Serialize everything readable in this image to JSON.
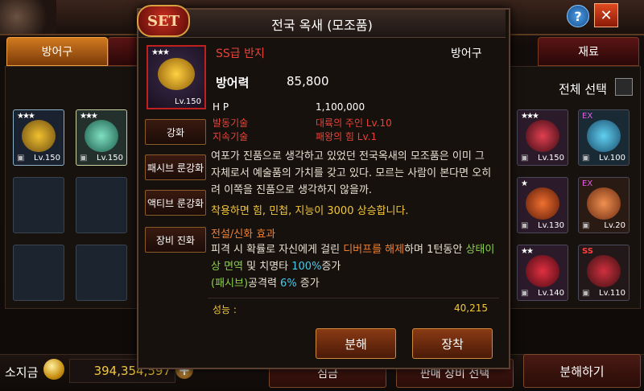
{
  "popup": {
    "badge": "SET",
    "title": "전국 옥새 (모조품)",
    "grade": "SS급 반지",
    "category": "방어구",
    "item_level": "Lv.150",
    "item_stars": "★★★",
    "main_stat_label": "방어력",
    "main_stat_value": "85,800",
    "stats": [
      {
        "label": "H P",
        "value": "1,100,000"
      },
      {
        "label": "발동기술",
        "value": "대륙의 주인 Lv.10"
      },
      {
        "label": "지속기술",
        "value": "패왕의 힘 Lv.1"
      }
    ],
    "description": [
      "여포가 진품으로 생각하고 있었던 전국옥새의 모조품은 이미 그",
      "자체로서 예술품의 가치를 갖고 있다. 모르는 사람이 본다면 오히",
      "려 이쪽을 진품으로 생각하지 않을까."
    ],
    "bonus": "착용하면 힘, 민첩, 지능이 3000 상승합니다.",
    "legend_title": "전설/신화 효과",
    "legend_line1_a": "피격 시 확률로 자신에게 걸린 ",
    "legend_line1_b": "디버프를 해제",
    "legend_line1_c": "하며 1턴동안 ",
    "legend_line1_d": "상태이",
    "legend_line2_a": "상 면역",
    "legend_line2_b": " 및 치명타 ",
    "legend_line2_c": "100%",
    "legend_line2_d": "증가",
    "legend_line3_a": "(패시브)",
    "legend_line3_b": "공격력 ",
    "legend_line3_c": "6%",
    "legend_line3_d": " 증가",
    "performance_label": "성능 :",
    "performance_value": "40,215",
    "side_buttons": [
      "강화",
      "패시브 룬강화",
      "액티브 룬강화",
      "장비 진화"
    ],
    "disassemble_label": "분해",
    "equip_label": "장착"
  },
  "tabs": {
    "armor": "방어구",
    "material": "재료"
  },
  "select_all_label": "전체 선택",
  "left_slots": [
    {
      "stars": "★★★",
      "level": "Lv.150",
      "color": "#d4a020"
    },
    {
      "stars": "★★★",
      "level": "Lv.150",
      "color": "#48b8a0"
    }
  ],
  "right_slots": [
    {
      "badge": "★★★",
      "level": "Lv.150",
      "color": "#c02030"
    },
    {
      "badge": "EX",
      "level": "Lv.100",
      "color": "#40a0c0"
    },
    {
      "badge": "★",
      "level": "Lv.130",
      "color": "#d05020"
    },
    {
      "badge": "EX",
      "level": "Lv.20",
      "color": "#e06030"
    },
    {
      "badge": "★★",
      "level": "Lv.140",
      "color": "#c01828"
    },
    {
      "badge": "SS",
      "level": "Lv.110",
      "color": "#b02030"
    }
  ],
  "bottom": {
    "gold_label": "소지금",
    "gold_value": "394,354,597",
    "btn1": "심금",
    "btn2": "판매 장비 선택",
    "btn3": "분해하기"
  },
  "icons": {
    "help": "?",
    "close": "✕",
    "plus": "+",
    "lock": "🔒"
  }
}
